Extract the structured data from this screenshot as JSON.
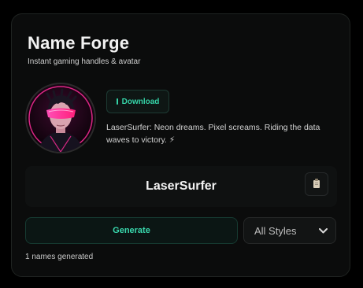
{
  "header": {
    "title": "Name Forge",
    "subtitle": "Instant gaming handles & avatar"
  },
  "profile": {
    "avatar_icon": "cyberpunk-avatar-image",
    "download_label": "Download",
    "bio": "LaserSurfer: Neon dreams. Pixel screams. Riding the data waves to victory. ⚡"
  },
  "result": {
    "name": "LaserSurfer",
    "copy_icon": "clipboard-icon"
  },
  "controls": {
    "generate_label": "Generate",
    "style_selected": "All Styles"
  },
  "status": {
    "count_text": "1 names generated"
  },
  "colors": {
    "accent": "#35d3a7",
    "background": "#0b0c0c",
    "neon_pink": "#ff2d9a"
  }
}
